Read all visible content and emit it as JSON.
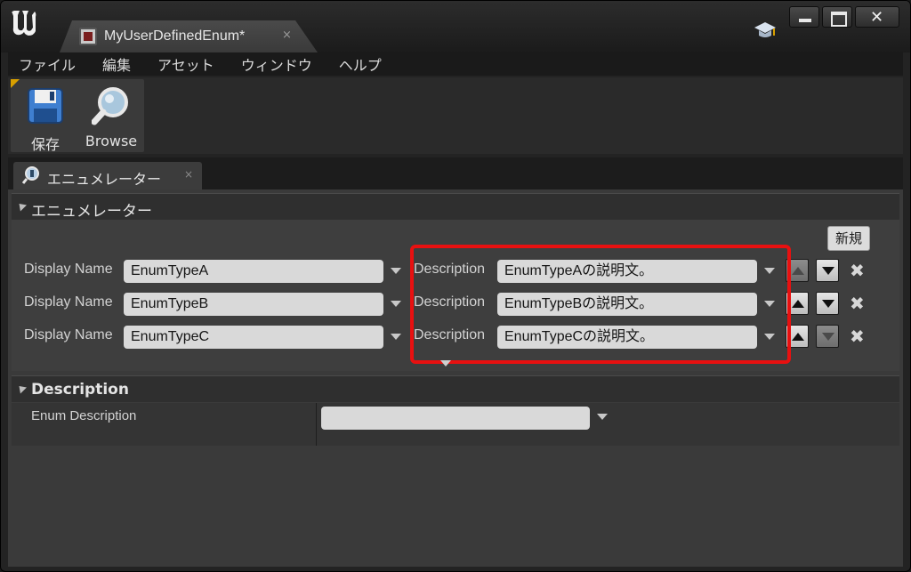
{
  "window": {
    "tab_title": "MyUserDefinedEnum*",
    "tab_close": "×",
    "close_glyph": "✕"
  },
  "menu": {
    "items": [
      "ファイル",
      "編集",
      "アセット",
      "ウィンドウ",
      "ヘルプ"
    ]
  },
  "toolbar": {
    "save_label": "保存",
    "browse_label": "Browse"
  },
  "panel_tab": {
    "label": "エニュメレーター",
    "close": "×"
  },
  "enumerators": {
    "header": "エニュメレーター",
    "new_button": "新規",
    "rows": [
      {
        "display_label": "Display Name",
        "display_value": "EnumTypeA",
        "desc_label": "Description",
        "desc_value": "EnumTypeAの説明文。",
        "up_enabled": false,
        "down_enabled": true
      },
      {
        "display_label": "Display Name",
        "display_value": "EnumTypeB",
        "desc_label": "Description",
        "desc_value": "EnumTypeBの説明文。",
        "up_enabled": true,
        "down_enabled": true
      },
      {
        "display_label": "Display Name",
        "display_value": "EnumTypeC",
        "desc_label": "Description",
        "desc_value": "EnumTypeCの説明文。",
        "up_enabled": true,
        "down_enabled": false
      }
    ],
    "remove_glyph": "✖"
  },
  "description_section": {
    "header": "Description",
    "field_label": "Enum Description",
    "field_value": ""
  },
  "colors": {
    "highlight": "#e81010",
    "accent_corner": "#d8a000"
  }
}
